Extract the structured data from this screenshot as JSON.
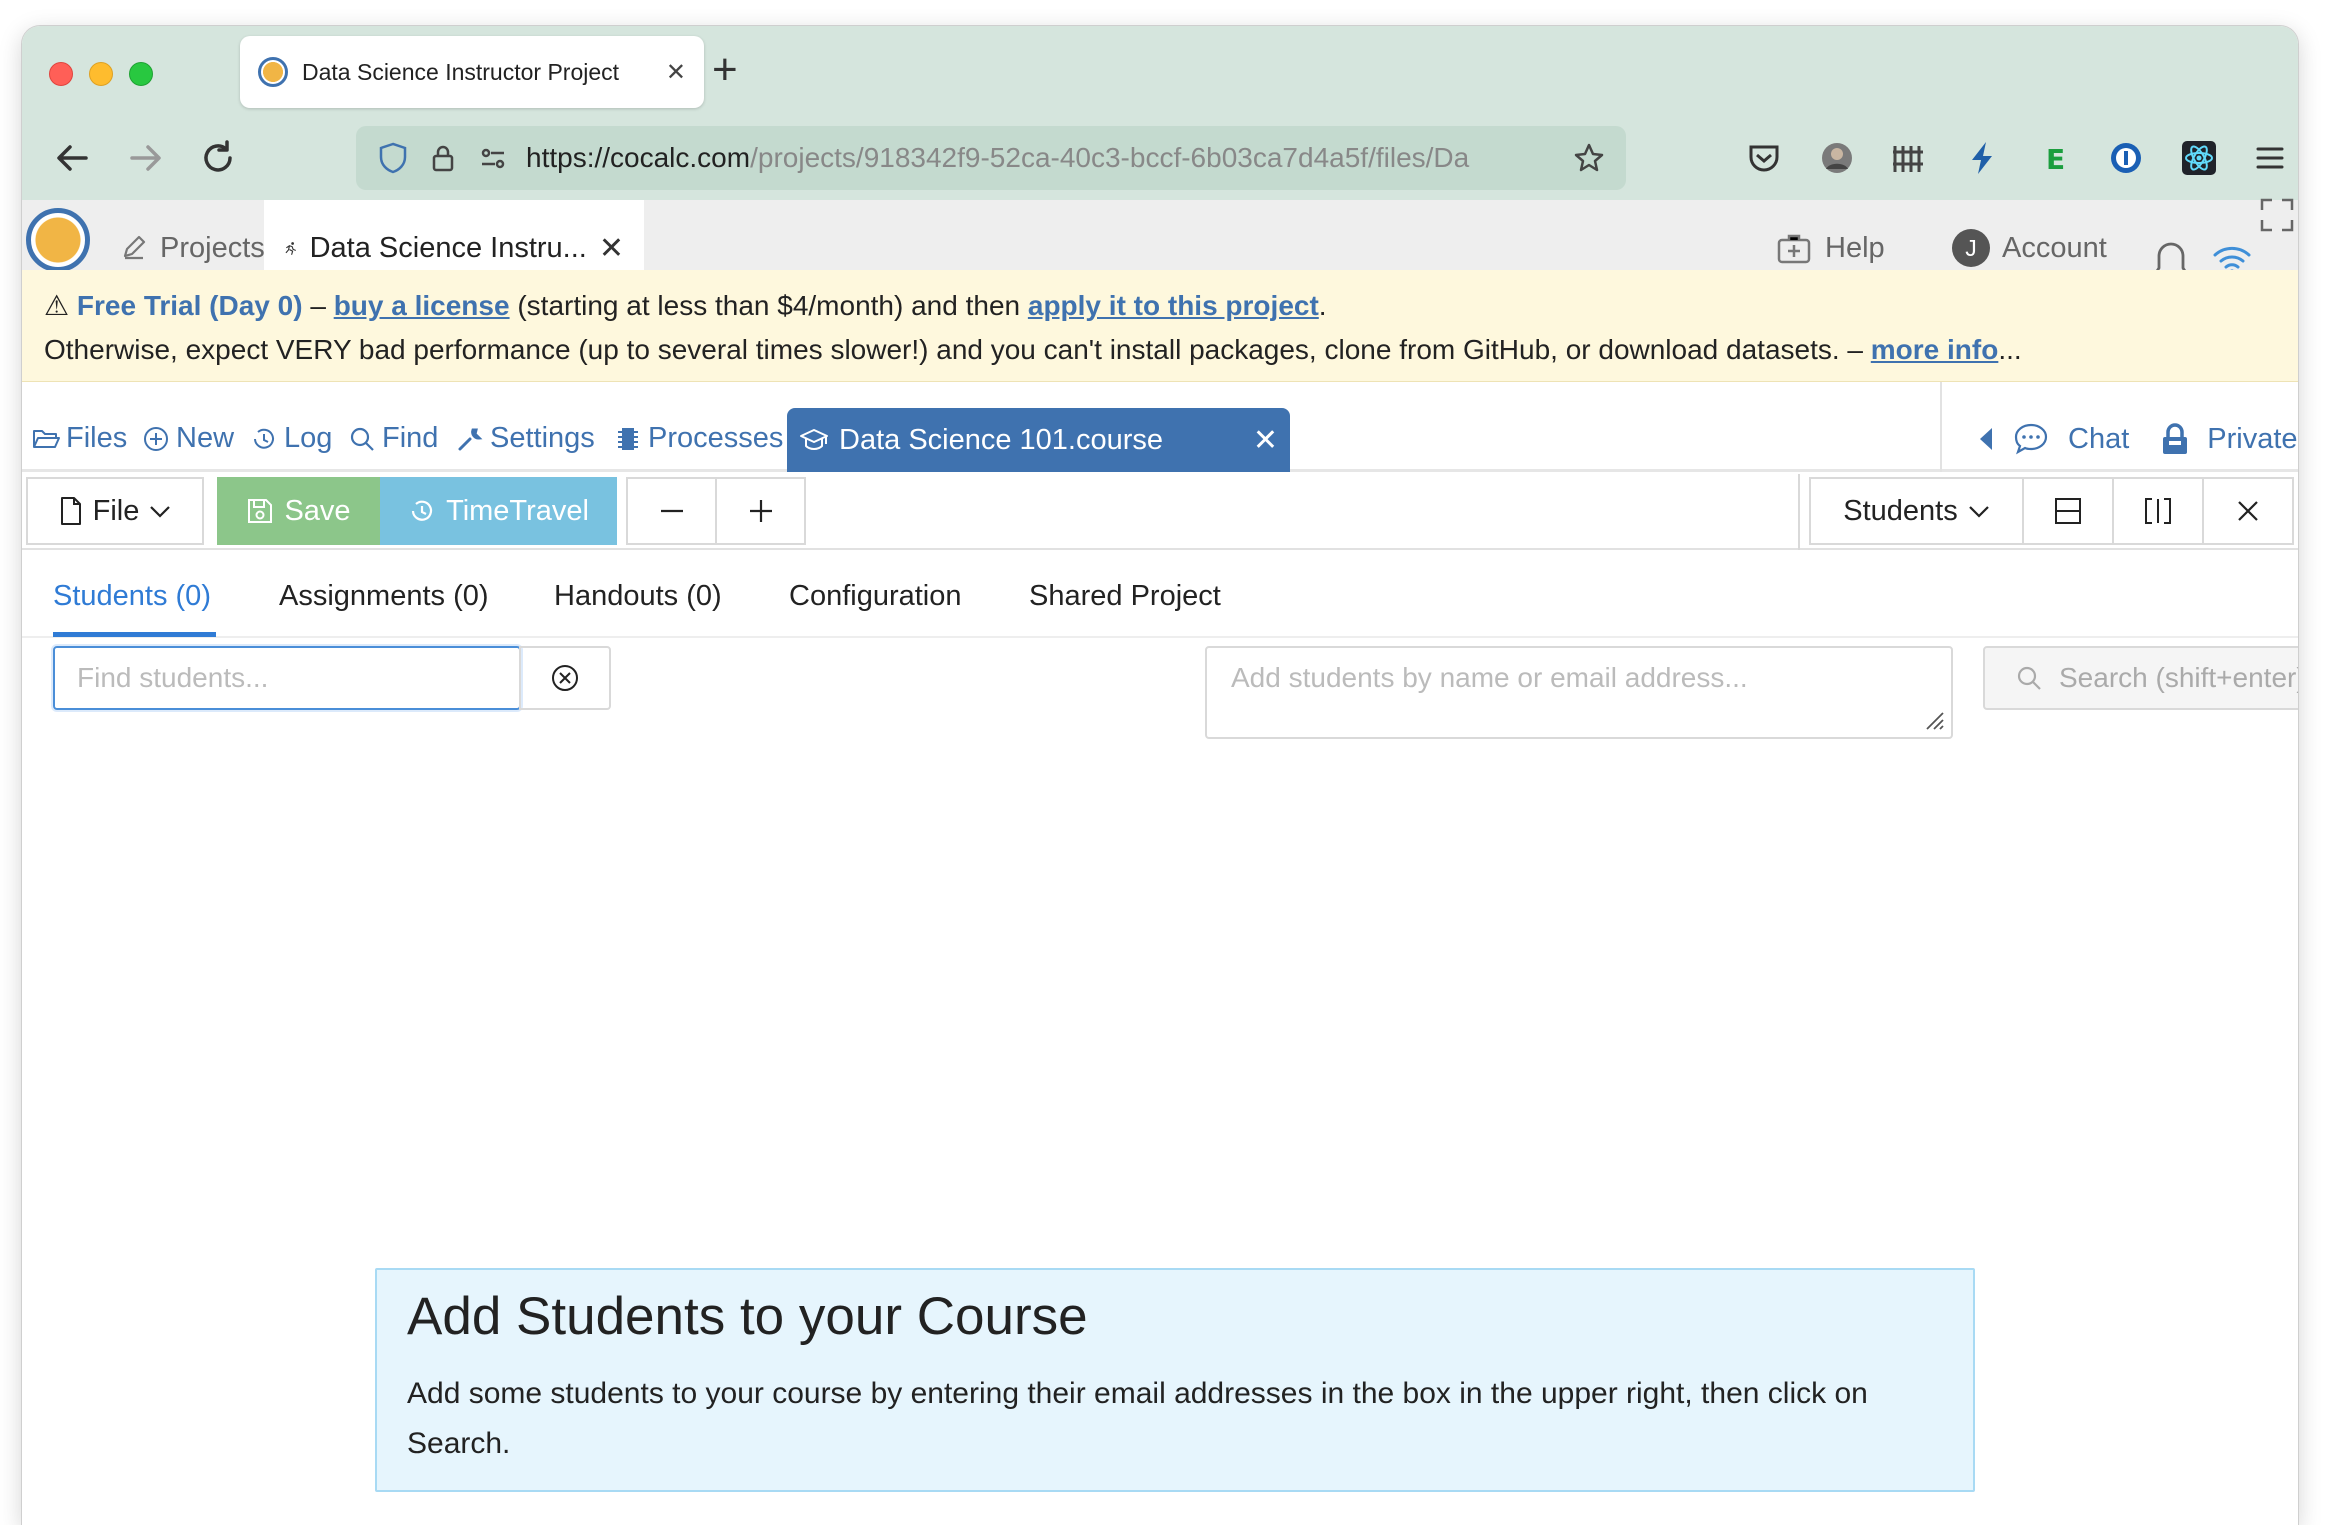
{
  "browser": {
    "tab_title": "Data Science Instructor Project",
    "url_domain": "https://cocalc.com",
    "url_path": "/projects/918342f9-52ca-40c3-bccf-6b03ca7d4a5f/files/Da"
  },
  "cocalc": {
    "projects_label": "Projects",
    "active_tab_label": "Data Science Instru...",
    "help_label": "Help",
    "account_initial": "J",
    "account_label": "Account"
  },
  "banner": {
    "trial_label": "Free Trial (Day 0)",
    "dash1": " – ",
    "buy_link": "buy a license",
    "text1": " (starting at less than $4/month) and then ",
    "apply_link": "apply it to this project",
    "period": ".",
    "text2": "Otherwise, expect VERY bad performance (up to several times slower!) and you can't install packages, clone from GitHub, or download datasets. – ",
    "more_link": "more info",
    "ellipsis": "..."
  },
  "project_tabs": {
    "files": "Files",
    "new": "New",
    "log": "Log",
    "find": "Find",
    "settings": "Settings",
    "processes": "Processes",
    "open_file": "Data Science 101.course",
    "chat": "Chat",
    "private": "Private"
  },
  "toolbar": {
    "file": "File",
    "save": "Save",
    "timetravel": "TimeTravel",
    "frame_select": "Students"
  },
  "course_tabs": {
    "students": "Students (0)",
    "assignments": "Assignments (0)",
    "handouts": "Handouts (0)",
    "configuration": "Configuration",
    "shared_project": "Shared Project"
  },
  "students_panel": {
    "find_placeholder": "Find students...",
    "add_placeholder": "Add students by name or email address...",
    "search_label": "Search (shift+enter)"
  },
  "info_box": {
    "title": "Add Students to your Course",
    "body": "Add some students to your course by entering their email addresses in the box in the upper right, then click on Search."
  }
}
